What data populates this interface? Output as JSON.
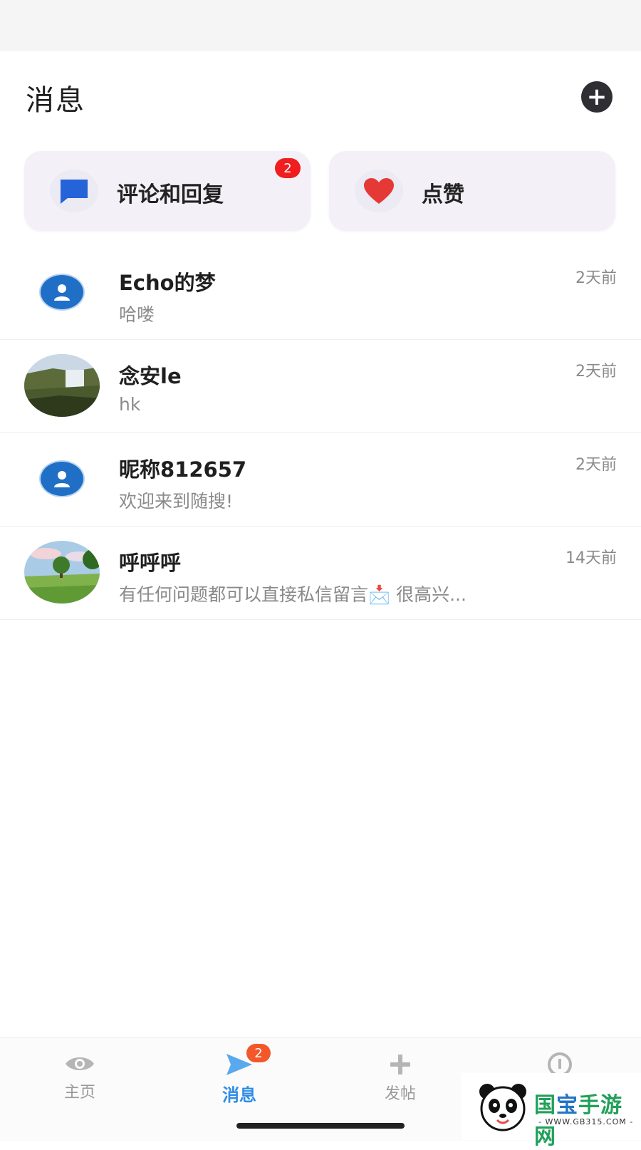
{
  "header": {
    "title": "消息"
  },
  "cards": [
    {
      "label": "评论和回复",
      "badge": "2",
      "icon": "comment-icon",
      "color": "#2563d9"
    },
    {
      "label": "点赞",
      "badge": "",
      "icon": "heart-icon",
      "color": "#e53935"
    }
  ],
  "conversations": [
    {
      "name": "Echo的梦",
      "message": "哈喽",
      "time": "2天前",
      "avatar": "default-user-avatar"
    },
    {
      "name": "念安le",
      "message": "hk",
      "time": "2天前",
      "avatar": "waterfall-photo-avatar"
    },
    {
      "name": "昵称812657",
      "message": "欢迎来到随搜!",
      "time": "2天前",
      "avatar": "default-user-avatar"
    },
    {
      "name": "呼呼呼",
      "message": "有任何问题都可以直接私信留言📩 很高兴...",
      "time": "14天前",
      "avatar": "tree-field-photo-avatar"
    }
  ],
  "tabbar": {
    "items": [
      {
        "label": "主页",
        "icon": "eye-icon",
        "active": false
      },
      {
        "label": "消息",
        "icon": "send-icon",
        "active": true,
        "badge": "2"
      },
      {
        "label": "发帖",
        "icon": "plus-icon",
        "active": false
      },
      {
        "label": "",
        "icon": "info-icon",
        "active": false
      }
    ]
  },
  "watermark": {
    "text_green1": "国",
    "text_blue": "宝",
    "text_green2": "手游网",
    "sub": "- WWW.GB315.COM -"
  },
  "colors": {
    "accent": "#2f8de4",
    "badge_red": "#f01e1e",
    "badge_orange": "#f2582a"
  }
}
